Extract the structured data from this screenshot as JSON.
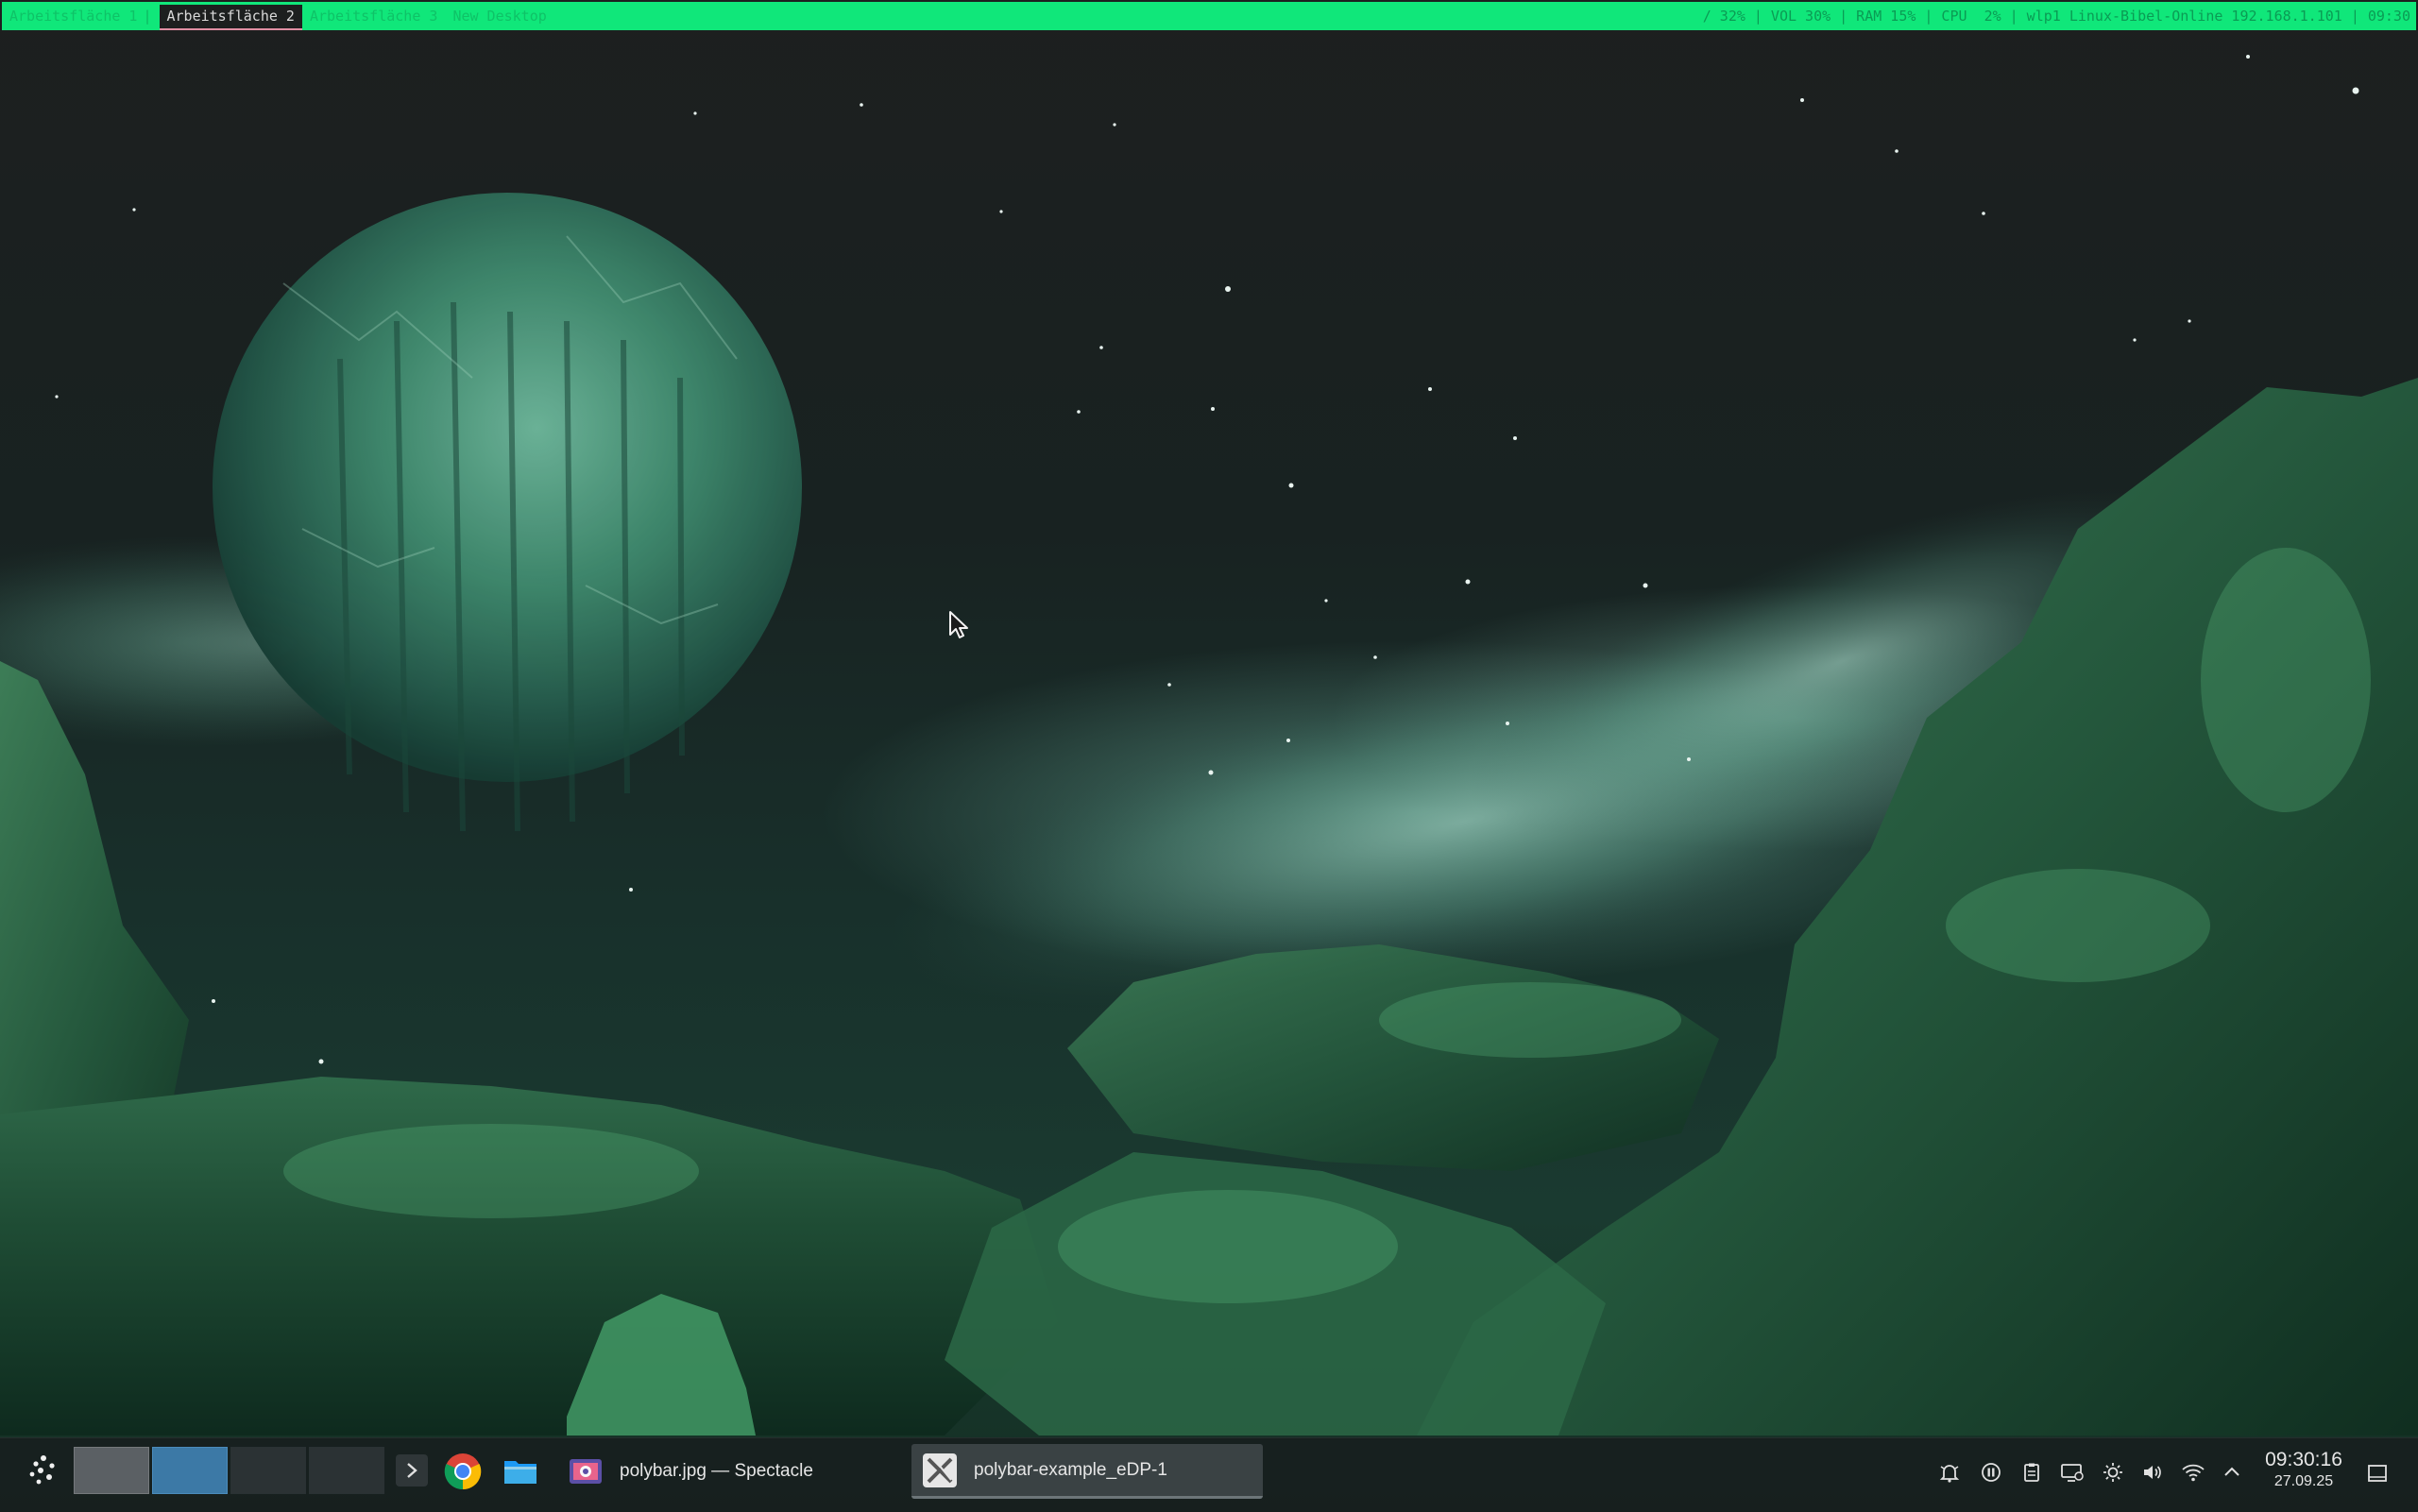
{
  "polybar": {
    "workspaces": [
      {
        "label": "Arbeitsfläche 1",
        "active": false
      },
      {
        "label": "Arbeitsfläche 2",
        "active": true
      },
      {
        "label": "Arbeitsfläche 3",
        "active": false
      },
      {
        "label": "New Desktop",
        "active": false
      }
    ],
    "modules": {
      "disk": "/ 32%",
      "volume": "VOL 30%",
      "ram": "RAM 15%",
      "cpu": "CPU  2%",
      "network": "wlp1 Linux-Bibel-Online 192.168.1.101",
      "time": "09:30"
    },
    "colors": {
      "bar": "#10e77a",
      "text": "#0fb662",
      "active_bg": "#1d1f1f",
      "active_underline": "#e08ea3"
    }
  },
  "panel": {
    "launcher_icon": "kde-application-launcher-icon",
    "pager": {
      "desktops": 4,
      "active_index": 2
    },
    "pager_more_icon": "chevron-right-icon",
    "pinned": [
      {
        "name": "Google Chrome",
        "icon": "chrome-icon"
      },
      {
        "name": "Dateien",
        "icon": "folder-icon"
      }
    ],
    "tasks": [
      {
        "title": "polybar.jpg — Spectacle",
        "icon": "spectacle-icon",
        "active": false
      },
      {
        "title": "polybar-example_eDP-1",
        "icon": "x11-icon",
        "active": true
      }
    ],
    "tray": [
      "notifications-icon",
      "media-pause-icon",
      "clipboard-icon",
      "display-configuration-icon",
      "brightness-icon",
      "volume-icon",
      "wifi-icon",
      "tray-expand-icon"
    ],
    "clock": {
      "time": "09:30:16",
      "date": "27.09.25"
    },
    "show_desktop_icon": "show-desktop-icon"
  }
}
